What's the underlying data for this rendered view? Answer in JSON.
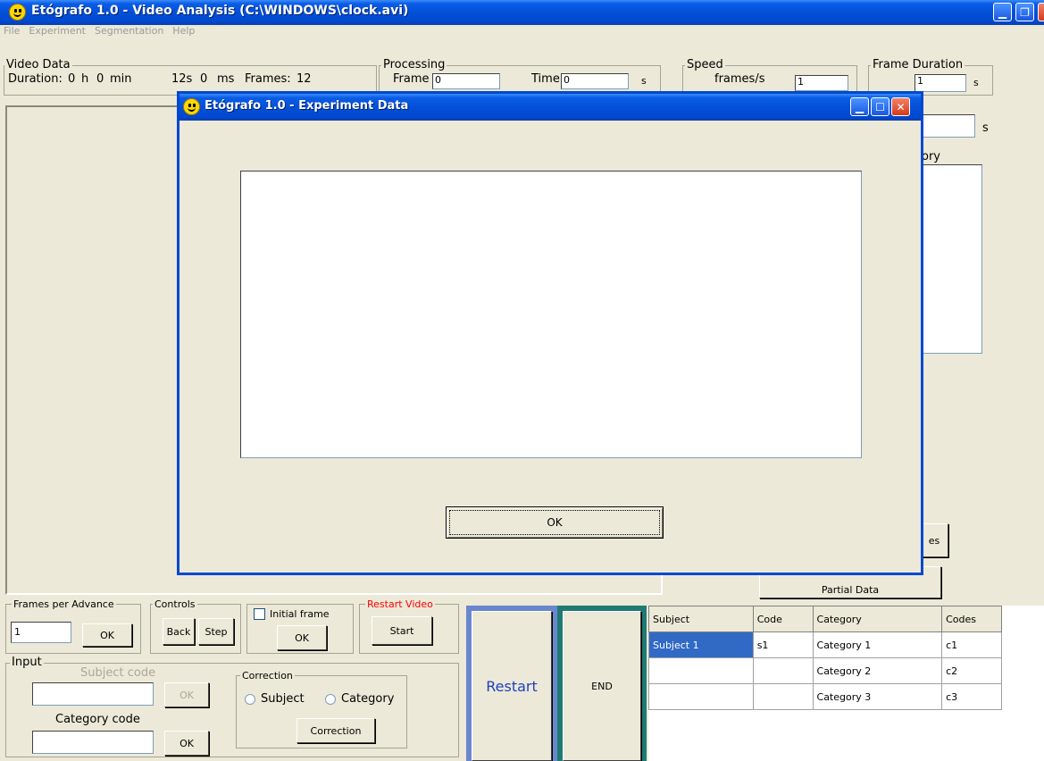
{
  "window": {
    "title": "Etógrafo 1.0 - Video Analysis (C:\\WINDOWS\\clock.avi)"
  },
  "menu": [
    "File",
    "Experiment",
    "Segmentation",
    "Help"
  ],
  "video_data": {
    "legend": "Video Data",
    "duration_label": "Duration:",
    "hours": "0",
    "h": "h",
    "minutes": "0",
    "min": "min",
    "seconds": "12s",
    "ms": "0",
    "ms_unit": "ms",
    "frames_label": "Frames:",
    "frames": "12"
  },
  "processing": {
    "legend": "Processing",
    "frame_label": "Frame",
    "frame_value": "0",
    "time_label": "Time",
    "time_value": "0",
    "unit": "s"
  },
  "speed": {
    "legend": "Speed",
    "label": "frames/s",
    "value": "1"
  },
  "frame_duration": {
    "legend": "Frame Duration",
    "value": "1",
    "unit": "s"
  },
  "behind_modal": {
    "s_label": "s",
    "ory_label": "ory",
    "es_label": "es",
    "partial_data": "Partial Data"
  },
  "modal": {
    "title": "Etógrafo 1.0 - Experiment Data",
    "ok": "OK"
  },
  "frames_per_advance": {
    "legend": "Frames per Advance",
    "value": "1",
    "ok": "OK"
  },
  "controls": {
    "legend": "Controls",
    "back": "Back",
    "step": "Step"
  },
  "initial_frame": {
    "label": "Initial frame",
    "ok": "OK"
  },
  "restart_video": {
    "legend": "Restart Video",
    "start": "Start",
    "color": "#ff0000"
  },
  "input": {
    "legend": "Input",
    "subject_code": "Subject code",
    "category_code": "Category code",
    "ok1": "OK",
    "ok2": "OK"
  },
  "correction": {
    "legend": "Correction",
    "subject": "Subject",
    "category": "Category",
    "button": "Correction"
  },
  "big_buttons": {
    "restart": "Restart",
    "end": "END",
    "restart_color": "#1f3fbf"
  },
  "table": {
    "headers": [
      "Subject",
      "Code",
      "Category",
      "Codes"
    ],
    "rows": [
      [
        "Subject 1",
        "s1",
        "Category 1",
        "c1"
      ],
      [
        "",
        "",
        "Category 2",
        "c2"
      ],
      [
        "",
        "",
        "Category 3",
        "c3"
      ]
    ]
  }
}
